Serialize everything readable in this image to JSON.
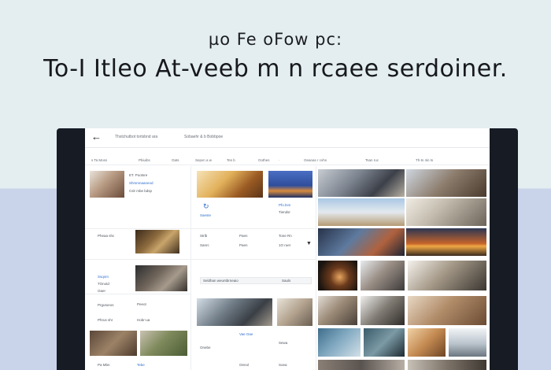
{
  "hero": {
    "small": "µo Fe oFow pc:",
    "big": "To-I Itleo At-veeb m n rcaee serdoiner."
  },
  "topbar": {
    "crumb1": "Thstchutbot tortsbnd ara",
    "crumb2": "Sobaehr & b Bobbpoe"
  },
  "toolbar": {
    "items": [
      "s  Ta  Moss",
      "Pbiuibs",
      "Oats",
      "Sepvn a  w",
      "Tes   b",
      "Oothes",
      "  ·  ",
      "Oeanas  r cvhs",
      "Tsan  ruc",
      "Th-ts  4in  ts"
    ]
  },
  "icons": {
    "back": "arrow-left-icon",
    "refresh": "refresh-icon",
    "caret": "caret-down-icon"
  },
  "cards": {
    "c1_title": "ET.  Pootsre",
    "c1_sub": "Shrsmnaaneod",
    "c1_meta": "Cslr  mbe bdsp",
    "c2_lbl": "Saeste",
    "c3_lbl": "Pfo.lnm",
    "c3_lbl2": "Tiendsr",
    "row2_left": "Pheaa  shc",
    "row2_a": "Strlb",
    "row2_b": "Paen",
    "row2_c": "Tone  Rn",
    "row2_d": "Ssqsrn",
    "row2_e": "TOnotd",
    "row2_f": "Oaer",
    "row2_g": "1O ruer",
    "row3_a": "Peeot",
    "row3_b": "Hobr-ua",
    "row3_c": "Sanrc",
    "row4_a": "Seldhan  weuntbrneaio",
    "row4_b": "Sauls",
    "row5_a": "Prgutoeos",
    "row5_b": "Phrus  shr",
    "row6_a": "Pa  Mbn",
    "row6_b": "Tebe",
    "row6_c": "Oenol",
    "row7_a": "Onebe",
    "row7_b": "Vae Oae",
    "row7_c": "Sewa",
    "row7_d": "Soea"
  }
}
